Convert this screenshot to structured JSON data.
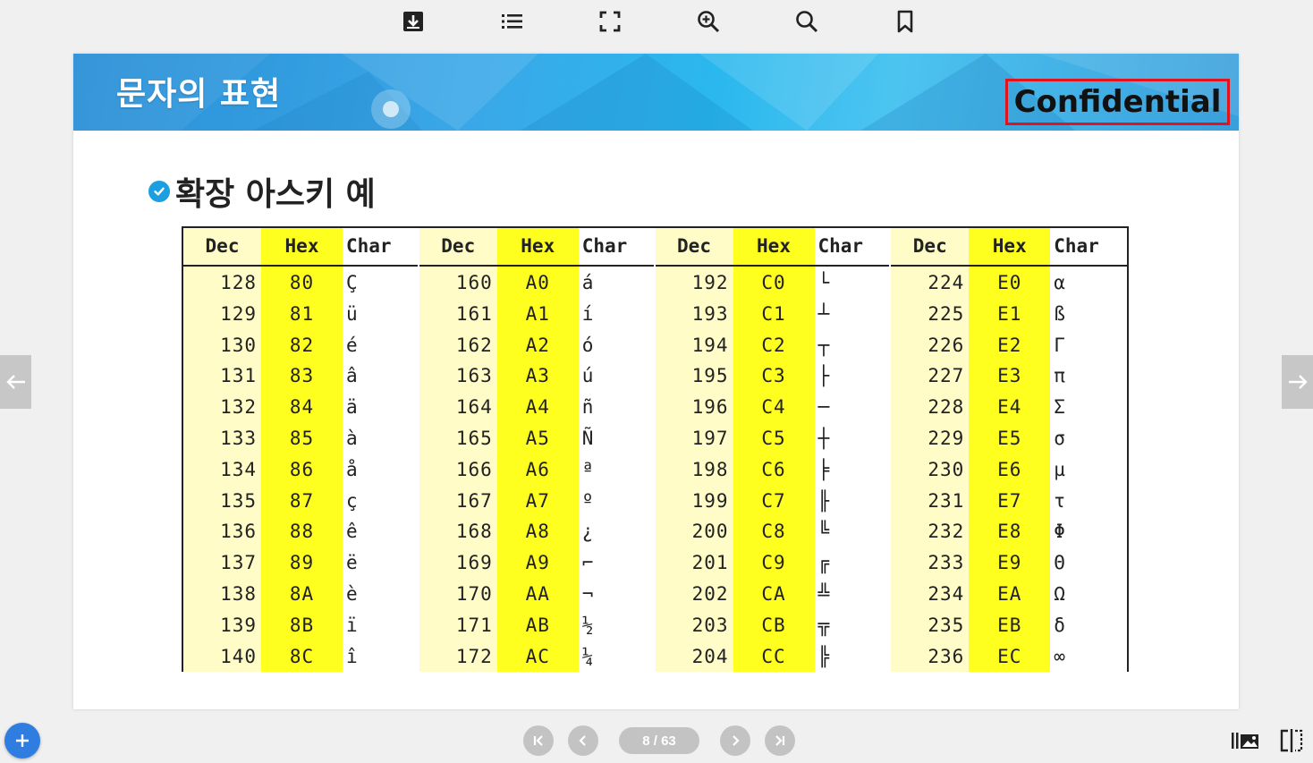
{
  "toolbar": {
    "icons": [
      "download-icon",
      "list-icon",
      "fullscreen-icon",
      "zoom-in-icon",
      "search-icon",
      "bookmark-icon"
    ]
  },
  "slide": {
    "banner_title": "문자의 표현",
    "confidential_label": "Confidential",
    "section_title": "확장 아스키 예",
    "table": {
      "headers": {
        "dec": "Dec",
        "hex": "Hex",
        "char": "Char"
      },
      "groups": [
        {
          "rows": [
            [
              "128",
              "80",
              "Ç"
            ],
            [
              "129",
              "81",
              "ü"
            ],
            [
              "130",
              "82",
              "é"
            ],
            [
              "131",
              "83",
              "â"
            ],
            [
              "132",
              "84",
              "ä"
            ],
            [
              "133",
              "85",
              "à"
            ],
            [
              "134",
              "86",
              "å"
            ],
            [
              "135",
              "87",
              "ç"
            ],
            [
              "136",
              "88",
              "ê"
            ],
            [
              "137",
              "89",
              "ë"
            ],
            [
              "138",
              "8A",
              "è"
            ],
            [
              "139",
              "8B",
              "ï"
            ],
            [
              "140",
              "8C",
              "î"
            ]
          ]
        },
        {
          "rows": [
            [
              "160",
              "A0",
              "á"
            ],
            [
              "161",
              "A1",
              "í"
            ],
            [
              "162",
              "A2",
              "ó"
            ],
            [
              "163",
              "A3",
              "ú"
            ],
            [
              "164",
              "A4",
              "ñ"
            ],
            [
              "165",
              "A5",
              "Ñ"
            ],
            [
              "166",
              "A6",
              "ª"
            ],
            [
              "167",
              "A7",
              "º"
            ],
            [
              "168",
              "A8",
              "¿"
            ],
            [
              "169",
              "A9",
              "⌐"
            ],
            [
              "170",
              "AA",
              "¬"
            ],
            [
              "171",
              "AB",
              "½"
            ],
            [
              "172",
              "AC",
              "¼"
            ]
          ]
        },
        {
          "rows": [
            [
              "192",
              "C0",
              "└"
            ],
            [
              "193",
              "C1",
              "┴"
            ],
            [
              "194",
              "C2",
              "┬"
            ],
            [
              "195",
              "C3",
              "├"
            ],
            [
              "196",
              "C4",
              "─"
            ],
            [
              "197",
              "C5",
              "┼"
            ],
            [
              "198",
              "C6",
              "╞"
            ],
            [
              "199",
              "C7",
              "╟"
            ],
            [
              "200",
              "C8",
              "╚"
            ],
            [
              "201",
              "C9",
              "╔"
            ],
            [
              "202",
              "CA",
              "╩"
            ],
            [
              "203",
              "CB",
              "╦"
            ],
            [
              "204",
              "CC",
              "╠"
            ]
          ]
        },
        {
          "rows": [
            [
              "224",
              "E0",
              "α"
            ],
            [
              "225",
              "E1",
              "ß"
            ],
            [
              "226",
              "E2",
              "Γ"
            ],
            [
              "227",
              "E3",
              "π"
            ],
            [
              "228",
              "E4",
              "Σ"
            ],
            [
              "229",
              "E5",
              "σ"
            ],
            [
              "230",
              "E6",
              "µ"
            ],
            [
              "231",
              "E7",
              "τ"
            ],
            [
              "232",
              "E8",
              "Φ"
            ],
            [
              "233",
              "E9",
              "Θ"
            ],
            [
              "234",
              "EA",
              "Ω"
            ],
            [
              "235",
              "EB",
              "δ"
            ],
            [
              "236",
              "EC",
              "∞"
            ]
          ]
        }
      ]
    }
  },
  "pagination": {
    "indicator": "8 / 63",
    "icons": [
      "first-page-icon",
      "prev-page-icon",
      "next-page-icon",
      "last-page-icon"
    ]
  },
  "colors": {
    "hex_column": "#ffff1f",
    "dec_column": "#fffcc8",
    "confidential_border": "#e1131c",
    "fab": "#2f7de1",
    "banner": "#2ab8ee"
  }
}
